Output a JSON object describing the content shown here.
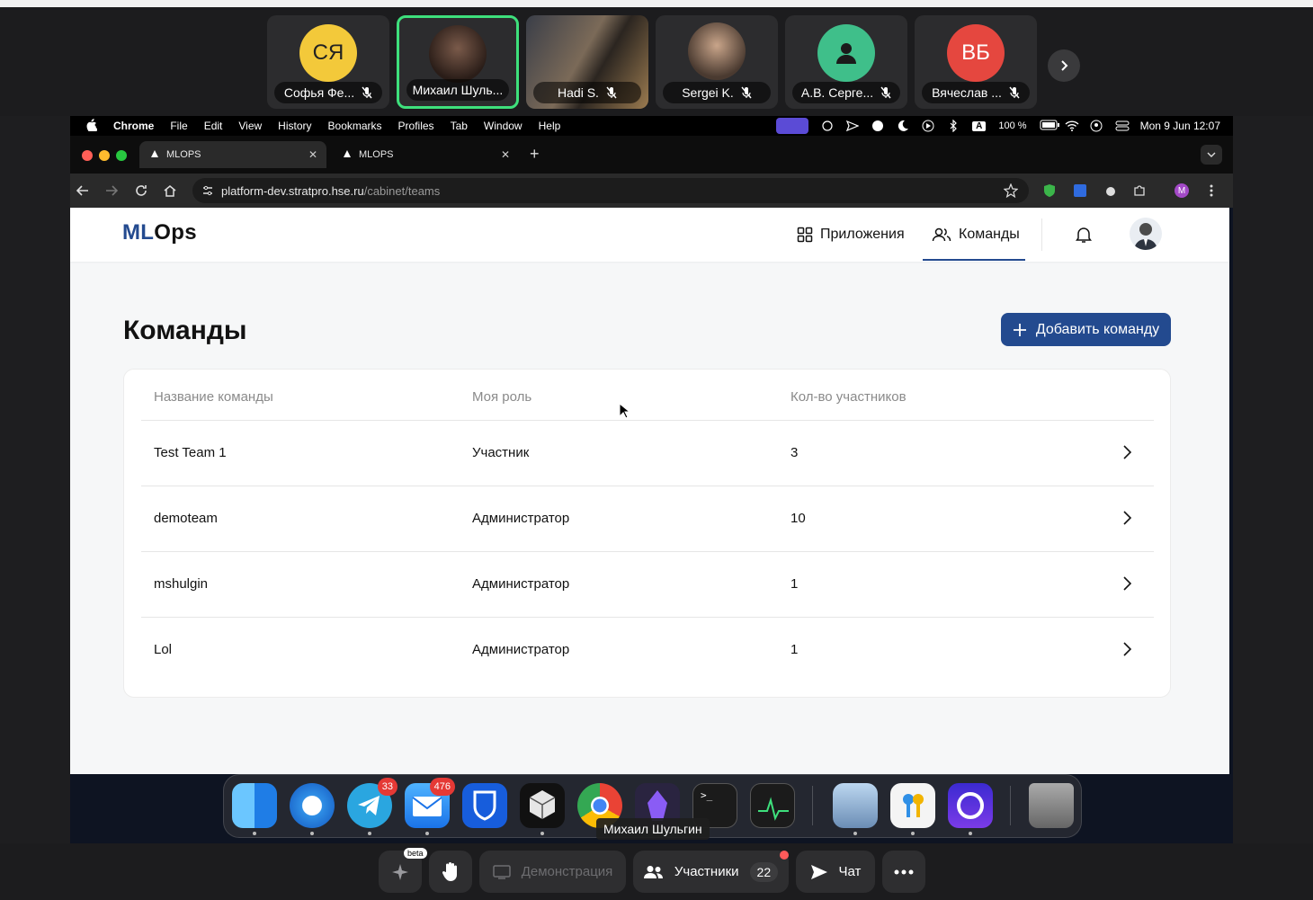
{
  "participants": [
    {
      "initials": "СЯ",
      "name": "Софья Фе...",
      "color": "#f3c93a"
    },
    {
      "initials": "",
      "name": "Михаил Шуль...",
      "color": ""
    },
    {
      "initials": "",
      "name": "Hadi S.",
      "color": ""
    },
    {
      "initials": "",
      "name": "Sergei K.",
      "color": ""
    },
    {
      "initials": "",
      "name": "А.В. Серге...",
      "color": "#3fbf8a"
    },
    {
      "initials": "ВБ",
      "name": "Вячеслав ...",
      "color": "#e5473f"
    }
  ],
  "menubar": {
    "app": "Chrome",
    "items": [
      "File",
      "Edit",
      "View",
      "History",
      "Bookmarks",
      "Profiles",
      "Tab",
      "Window",
      "Help"
    ],
    "battery": "100 %",
    "datetime": "Mon 9 Jun  12:07"
  },
  "browser": {
    "tabs": [
      "MLOPS",
      "MLOPS"
    ],
    "url_host": "platform-dev.stratpro.hse.ru",
    "url_path": "/cabinet/teams",
    "profile_initial": "M"
  },
  "app": {
    "logo_ml": "ML",
    "logo_ops": "Ops",
    "nav": [
      "Приложения",
      "Команды"
    ],
    "page_title": "Команды",
    "add_button": "Добавить команду",
    "columns": [
      "Название команды",
      "Моя роль",
      "Кол-во участников"
    ],
    "rows": [
      {
        "name": "Test Team 1",
        "role": "Участник",
        "count": "3"
      },
      {
        "name": "demoteam",
        "role": "Администратор",
        "count": "10"
      },
      {
        "name": "mshulgin",
        "role": "Администратор",
        "count": "1"
      },
      {
        "name": "Lol",
        "role": "Администратор",
        "count": "1"
      }
    ]
  },
  "dock": {
    "telegram_badge": "33",
    "mail_badge": "476",
    "tooltip": "Михаил Шульгин"
  },
  "bottombar": {
    "beta": "beta",
    "demo": "Демонстрация",
    "participants": "Участники",
    "participants_count": "22",
    "chat": "Чат"
  }
}
